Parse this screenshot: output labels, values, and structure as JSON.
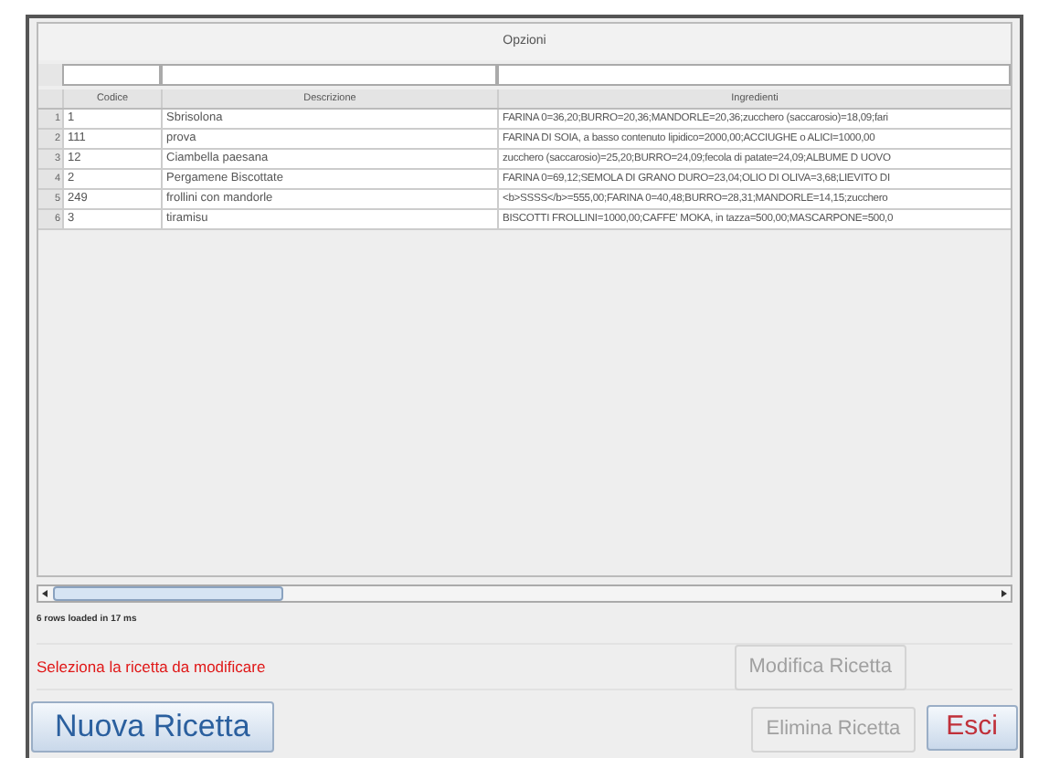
{
  "panel": {
    "title": "Opzioni"
  },
  "table": {
    "columns": [
      "Codice",
      "Descrizione",
      "Ingredienti"
    ],
    "rows": [
      {
        "number": "1",
        "cells": [
          "1",
          "Sbrisolona",
          "FARINA 0=36,20;BURRO=20,36;MANDORLE=20,36;zucchero (saccarosio)=18,09;fari"
        ]
      },
      {
        "number": "2",
        "cells": [
          "111",
          "prova",
          "FARINA DI SOIA, a basso contenuto lipidico=2000,00;ACCIUGHE o ALICI=1000,00"
        ]
      },
      {
        "number": "3",
        "cells": [
          "12",
          "Ciambella paesana",
          "zucchero (saccarosio)=25,20;BURRO=24,09;fecola di patate=24,09;ALBUME D UOVO"
        ]
      },
      {
        "number": "4",
        "cells": [
          "2",
          "Pergamene Biscottate",
          "FARINA 0=69,12;SEMOLA DI GRANO DURO=23,04;OLIO DI OLIVA=3,68;LIEVITO DI"
        ]
      },
      {
        "number": "5",
        "cells": [
          "249",
          "frollini con mandorle",
          "<b>SSSS</b>=555,00;FARINA 0=40,48;BURRO=28,31;MANDORLE=14,15;zucchero"
        ]
      },
      {
        "number": "6",
        "cells": [
          "3",
          "tiramisu",
          "BISCOTTI FROLLINI=1000,00;CAFFE' MOKA, in tazza=500,00;MASCARPONE=500,0"
        ]
      }
    ]
  },
  "load_status": "6 rows loaded  in 17 ms",
  "message": "Seleziona la ricetta da modificare",
  "buttons": [
    {
      "label": "Modifica Ricetta",
      "disabled": true
    },
    {
      "label": "Nuova Ricetta",
      "disabled": false,
      "color": "#2a5f9e"
    },
    {
      "label": "Elimina Ricetta",
      "disabled": true
    },
    {
      "label": "Esci",
      "disabled": false,
      "color": "#c0303a"
    }
  ]
}
